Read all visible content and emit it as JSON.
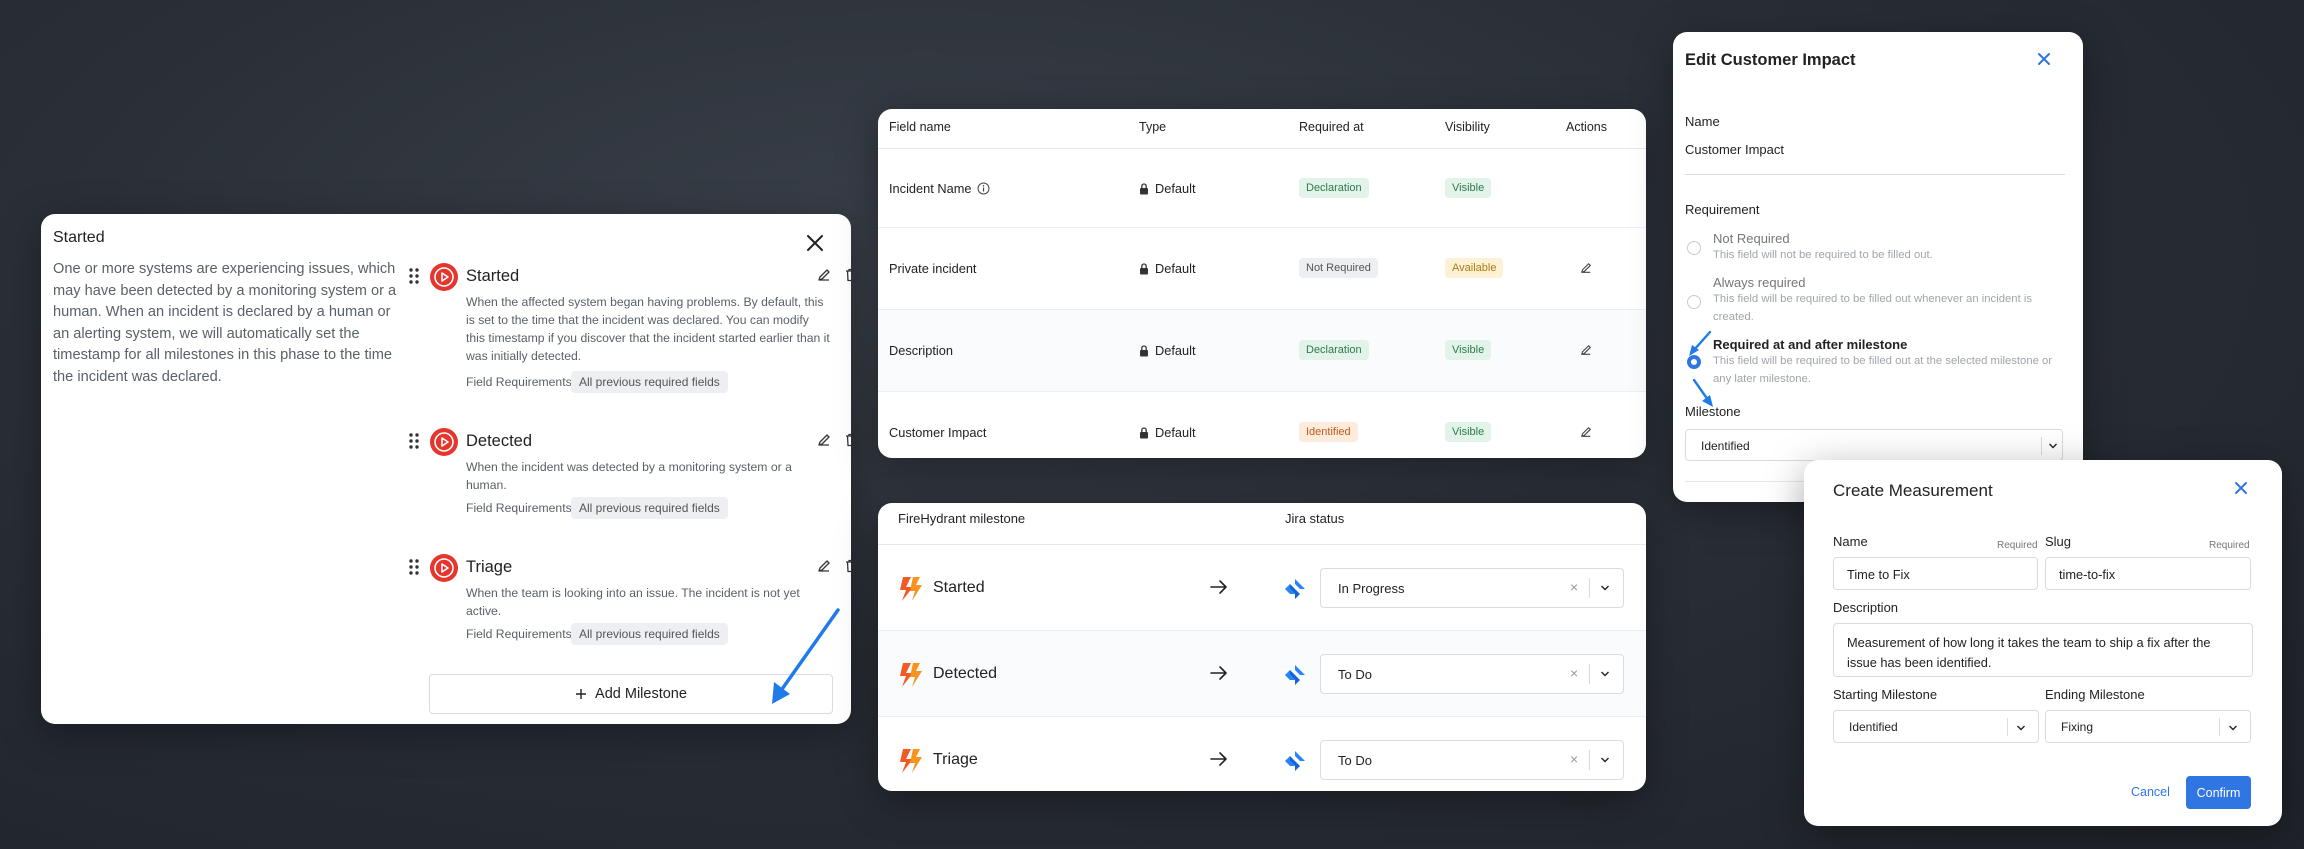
{
  "colors": {
    "accent_blue": "#2f76e3",
    "milestone_red": "#e5352d",
    "badge_green_bg": "#e2f4e9",
    "badge_orange_bg": "#fdebdc",
    "badge_yellow_bg": "#fdf1d6"
  },
  "milestones_modal": {
    "title": "Started",
    "description": "One or more systems are experiencing issues, which may have been detected by a monitoring system or a human. When an incident is declared by a human or an alerting system, we will automatically set the timestamp for all milestones in this phase to the time the incident was declared.",
    "close_icon": "close-icon",
    "items": [
      {
        "name": "Started",
        "description": "When the affected system began having problems. By default, this is set to the time that the incident was declared. You can modify this timestamp if you discover that the incident started earlier than it was initially detected.",
        "field_requirements_label": "Field Requirements:",
        "field_requirements_value": "All previous required fields"
      },
      {
        "name": "Detected",
        "description": "When the incident was detected by a monitoring system or a human.",
        "field_requirements_label": "Field Requirements:",
        "field_requirements_value": "All previous required fields"
      },
      {
        "name": "Triage",
        "description": "When the team is looking into an issue. The incident is not yet active.",
        "field_requirements_label": "Field Requirements:",
        "field_requirements_value": "All previous required fields"
      }
    ],
    "add_button_label": "Add Milestone"
  },
  "fields_table": {
    "columns": [
      "Field name",
      "Type",
      "Required at",
      "Visibility",
      "Actions"
    ],
    "rows": [
      {
        "name": "Incident Name",
        "has_info_icon": true,
        "type": "Default",
        "required_at": "Declaration",
        "required_style": "green",
        "visibility": "Visible",
        "visibility_style": "green"
      },
      {
        "name": "Private incident",
        "has_info_icon": false,
        "type": "Default",
        "required_at": "Not Required",
        "required_style": "gray",
        "visibility": "Available",
        "visibility_style": "yellow"
      },
      {
        "name": "Description",
        "has_info_icon": false,
        "type": "Default",
        "required_at": "Declaration",
        "required_style": "green",
        "visibility": "Visible",
        "visibility_style": "green"
      },
      {
        "name": "Customer Impact",
        "has_info_icon": false,
        "type": "Default",
        "required_at": "Identified",
        "required_style": "orange",
        "visibility": "Visible",
        "visibility_style": "green"
      }
    ]
  },
  "jira_mapping": {
    "columns": [
      "FireHydrant milestone",
      "Jira status"
    ],
    "rows": [
      {
        "milestone": "Started",
        "status": "In Progress"
      },
      {
        "milestone": "Detected",
        "status": "To Do"
      },
      {
        "milestone": "Triage",
        "status": "To Do"
      }
    ],
    "clear_glyph": "×"
  },
  "edit_modal": {
    "title": "Edit Customer Impact",
    "name_label": "Name",
    "name_value": "Customer Impact",
    "requirement_label": "Requirement",
    "options": [
      {
        "title": "Not Required",
        "subtitle": "This field will not be required to be filled out.",
        "selected": false
      },
      {
        "title": "Always required",
        "subtitle": "This field will be required to be filled out whenever an incident is created.",
        "selected": false
      },
      {
        "title": "Required at and after milestone",
        "subtitle": "This field will be required to be filled out at the selected milestone or any later milestone.",
        "selected": true
      }
    ],
    "milestone_label": "Milestone",
    "milestone_value": "Identified"
  },
  "measurement_modal": {
    "title": "Create Measurement",
    "name_label": "Name",
    "name_required": "Required",
    "name_value": "Time to Fix",
    "slug_label": "Slug",
    "slug_required": "Required",
    "slug_value": "time-to-fix",
    "description_label": "Description",
    "description_value": "Measurement of how long it takes the team to ship a fix after the issue has been identified.",
    "starting_label": "Starting Milestone",
    "starting_value": "Identified",
    "ending_label": "Ending Milestone",
    "ending_value": "Fixing",
    "cancel_label": "Cancel",
    "confirm_label": "Confirm"
  }
}
